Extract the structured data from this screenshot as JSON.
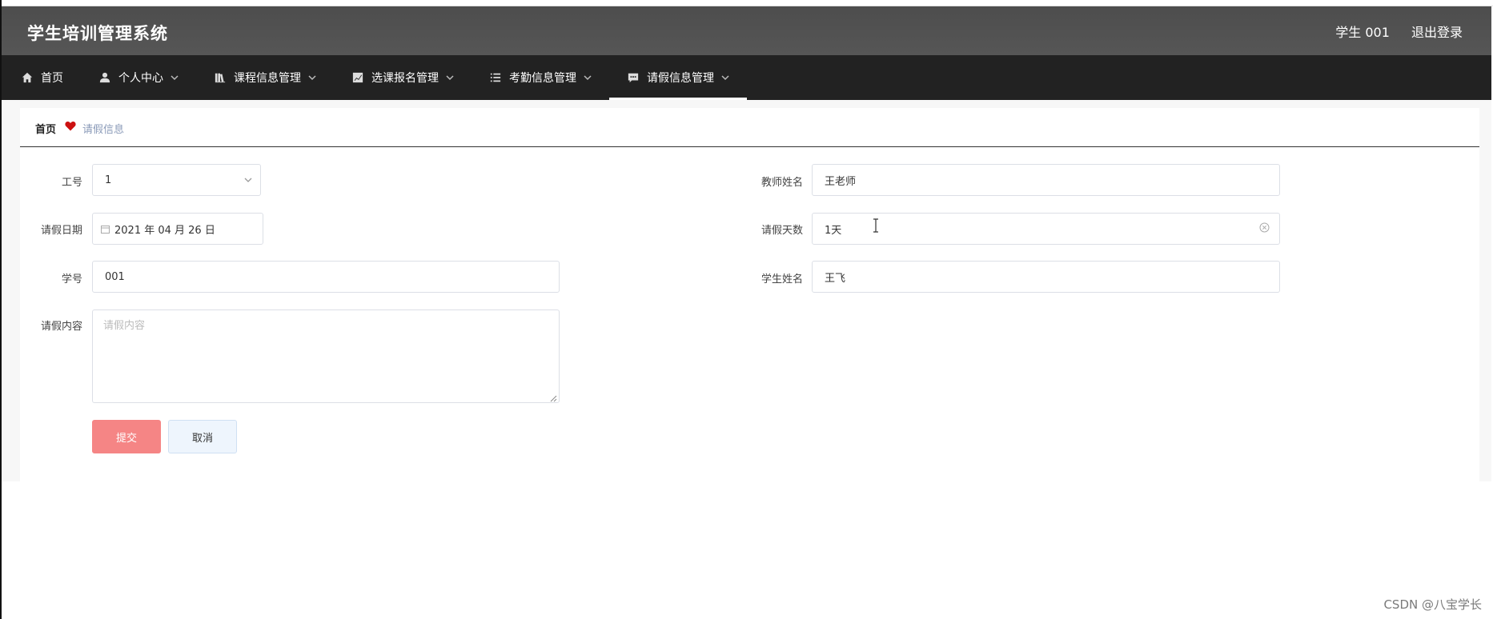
{
  "header": {
    "app_title": "学生培训管理系统",
    "user_label": "学生 001",
    "logout_label": "退出登录"
  },
  "nav": {
    "items": [
      {
        "label": "首页",
        "icon": "home-icon"
      },
      {
        "label": "个人中心",
        "icon": "user-icon"
      },
      {
        "label": "课程信息管理",
        "icon": "book-icon"
      },
      {
        "label": "选课报名管理",
        "icon": "chart-icon"
      },
      {
        "label": "考勤信息管理",
        "icon": "list-icon"
      },
      {
        "label": "请假信息管理",
        "icon": "message-icon",
        "active": true
      }
    ]
  },
  "breadcrumb": {
    "home": "首页",
    "current": "请假信息"
  },
  "form": {
    "job_no": {
      "label": "工号",
      "value": "1"
    },
    "teacher_name": {
      "label": "教师姓名",
      "value": "王老师"
    },
    "leave_date": {
      "label": "请假日期",
      "value": "2021 年 04 月 26 日"
    },
    "leave_days": {
      "label": "请假天数",
      "value": "1天"
    },
    "student_no": {
      "label": "学号",
      "value": "001"
    },
    "student_name": {
      "label": "学生姓名",
      "value": "王飞"
    },
    "leave_content": {
      "label": "请假内容",
      "placeholder": "请假内容",
      "value": ""
    },
    "submit_label": "提交",
    "cancel_label": "取消"
  },
  "colors": {
    "header_bg": "#4f4f4f",
    "nav_bg": "#222222",
    "submit_bg": "#f58585",
    "cancel_bg": "#eef5fd",
    "breadcrumb_heart": "#cc1111"
  },
  "watermark": "CSDN @八宝学长"
}
